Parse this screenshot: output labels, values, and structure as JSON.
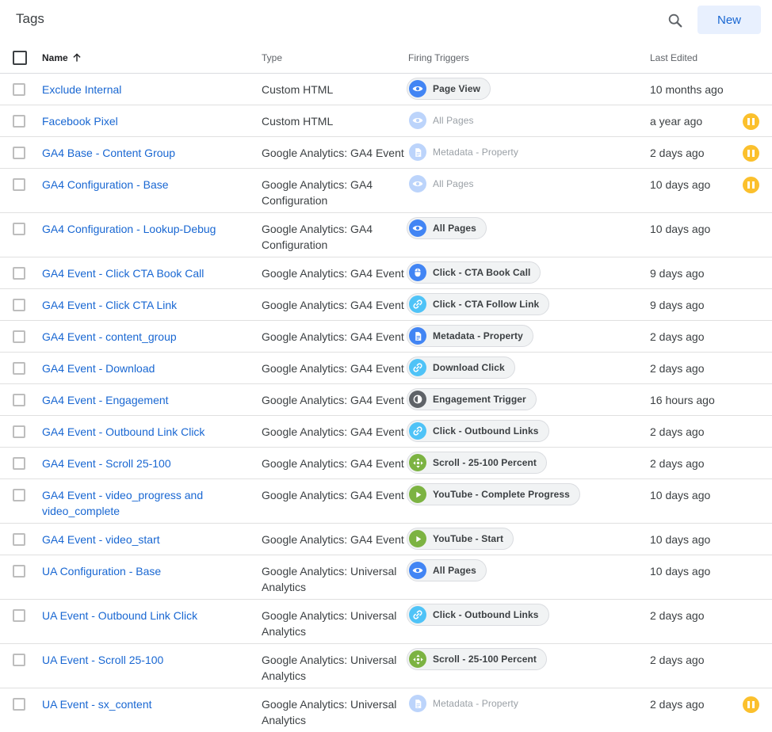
{
  "header": {
    "title": "Tags",
    "new_label": "New",
    "search_icon": "search-icon"
  },
  "columns": {
    "name": "Name",
    "type": "Type",
    "triggers": "Firing Triggers",
    "last_edited": "Last Edited",
    "sort": "ascending"
  },
  "trigger_colors": {
    "eye": "#4285f4",
    "doc": "#4285f4",
    "mouse": "#4285f4",
    "link": "#4fc3f7",
    "engagement": "#5f6368",
    "scroll": "#7cb342",
    "play": "#7cb342",
    "paused": "#fbc02d",
    "link_text": "#1967d2"
  },
  "rows": [
    {
      "name": "Exclude Internal",
      "type": "Custom HTML",
      "trigger": {
        "label": "Page View",
        "icon": "eye",
        "faded": false
      },
      "last_edited": "10 months ago",
      "paused": false
    },
    {
      "name": "Facebook Pixel",
      "type": "Custom HTML",
      "trigger": {
        "label": "All Pages",
        "icon": "eye",
        "faded": true
      },
      "last_edited": "a year ago",
      "paused": true
    },
    {
      "name": "GA4 Base - Content Group",
      "type": "Google Analytics: GA4 Event",
      "trigger": {
        "label": "Metadata - Property",
        "icon": "doc",
        "faded": true
      },
      "last_edited": "2 days ago",
      "paused": true
    },
    {
      "name": "GA4 Configuration - Base",
      "type": "Google Analytics: GA4 Configuration",
      "trigger": {
        "label": "All Pages",
        "icon": "eye",
        "faded": true
      },
      "last_edited": "10 days ago",
      "paused": true
    },
    {
      "name": "GA4 Configuration - Lookup-Debug",
      "type": "Google Analytics: GA4 Configuration",
      "trigger": {
        "label": "All Pages",
        "icon": "eye",
        "faded": false
      },
      "last_edited": "10 days ago",
      "paused": false
    },
    {
      "name": "GA4 Event - Click CTA Book Call",
      "type": "Google Analytics: GA4 Event",
      "trigger": {
        "label": "Click - CTA Book Call",
        "icon": "mouse",
        "faded": false
      },
      "last_edited": "9 days ago",
      "paused": false
    },
    {
      "name": "GA4 Event - Click CTA Link",
      "type": "Google Analytics: GA4 Event",
      "trigger": {
        "label": "Click - CTA Follow Link",
        "icon": "link",
        "faded": false
      },
      "last_edited": "9 days ago",
      "paused": false
    },
    {
      "name": "GA4 Event - content_group",
      "type": "Google Analytics: GA4 Event",
      "trigger": {
        "label": "Metadata - Property",
        "icon": "doc",
        "faded": false
      },
      "last_edited": "2 days ago",
      "paused": false
    },
    {
      "name": "GA4 Event - Download",
      "type": "Google Analytics: GA4 Event",
      "trigger": {
        "label": "Download Click",
        "icon": "link",
        "faded": false
      },
      "last_edited": "2 days ago",
      "paused": false
    },
    {
      "name": "GA4 Event - Engagement",
      "type": "Google Analytics: GA4 Event",
      "trigger": {
        "label": "Engagement Trigger",
        "icon": "engagement",
        "faded": false
      },
      "last_edited": "16 hours ago",
      "paused": false
    },
    {
      "name": "GA4 Event - Outbound Link Click",
      "type": "Google Analytics: GA4 Event",
      "trigger": {
        "label": "Click - Outbound Links",
        "icon": "link",
        "faded": false
      },
      "last_edited": "2 days ago",
      "paused": false
    },
    {
      "name": "GA4 Event - Scroll 25-100",
      "type": "Google Analytics: GA4 Event",
      "trigger": {
        "label": "Scroll - 25-100 Percent",
        "icon": "scroll",
        "faded": false
      },
      "last_edited": "2 days ago",
      "paused": false
    },
    {
      "name": "GA4 Event - video_progress and video_complete",
      "type": "Google Analytics: GA4 Event",
      "trigger": {
        "label": "YouTube - Complete Progress",
        "icon": "play",
        "faded": false
      },
      "last_edited": "10 days ago",
      "paused": false
    },
    {
      "name": "GA4 Event - video_start",
      "type": "Google Analytics: GA4 Event",
      "trigger": {
        "label": "YouTube - Start",
        "icon": "play",
        "faded": false
      },
      "last_edited": "10 days ago",
      "paused": false
    },
    {
      "name": "UA Configuration - Base",
      "type": "Google Analytics: Universal Analytics",
      "trigger": {
        "label": "All Pages",
        "icon": "eye",
        "faded": false
      },
      "last_edited": "10 days ago",
      "paused": false
    },
    {
      "name": "UA Event - Outbound Link Click",
      "type": "Google Analytics: Universal Analytics",
      "trigger": {
        "label": "Click - Outbound Links",
        "icon": "link",
        "faded": false
      },
      "last_edited": "2 days ago",
      "paused": false
    },
    {
      "name": "UA Event - Scroll 25-100",
      "type": "Google Analytics: Universal Analytics",
      "trigger": {
        "label": "Scroll - 25-100 Percent",
        "icon": "scroll",
        "faded": false
      },
      "last_edited": "2 days ago",
      "paused": false
    },
    {
      "name": "UA Event - sx_content",
      "type": "Google Analytics: Universal Analytics",
      "trigger": {
        "label": "Metadata - Property",
        "icon": "doc",
        "faded": true
      },
      "last_edited": "2 days ago",
      "paused": true
    }
  ]
}
